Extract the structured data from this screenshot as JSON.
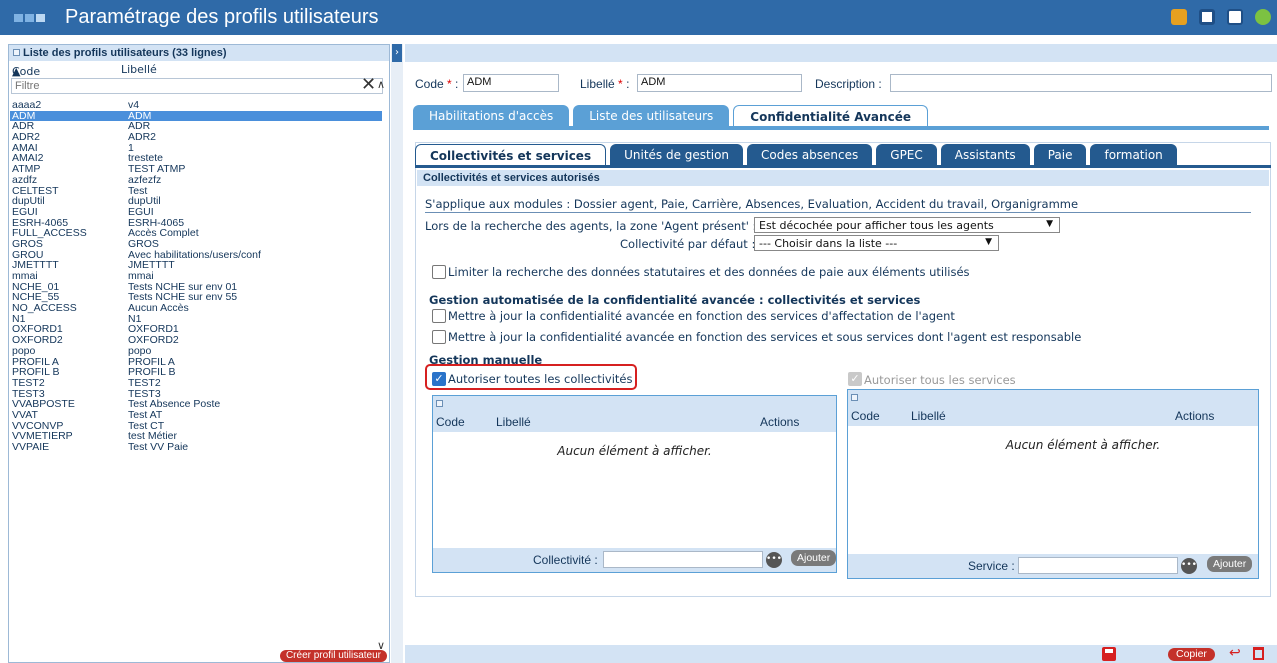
{
  "window": {
    "title": "Paramétrage des profils utilisateurs"
  },
  "left": {
    "header": "Liste des profils utilisateurs (33 lignes)",
    "col_code": "Code",
    "col_label": "Libellé",
    "filter_placeholder": "Filtre",
    "create_button": "Créer profil utilisateur",
    "rows": [
      {
        "code": "aaaa2",
        "label": "v4"
      },
      {
        "code": "ADM",
        "label": "ADM",
        "selected": true
      },
      {
        "code": "ADR",
        "label": "ADR"
      },
      {
        "code": "ADR2",
        "label": "ADR2"
      },
      {
        "code": "AMAI",
        "label": "1"
      },
      {
        "code": "AMAI2",
        "label": "trestete"
      },
      {
        "code": "ATMP",
        "label": "TEST ATMP"
      },
      {
        "code": "azdfz",
        "label": "azfezfz"
      },
      {
        "code": "CELTEST",
        "label": "Test"
      },
      {
        "code": "dupUtil",
        "label": "dupUtil"
      },
      {
        "code": "EGUI",
        "label": "EGUI"
      },
      {
        "code": "ESRH-4065",
        "label": "ESRH-4065"
      },
      {
        "code": "FULL_ACCESS",
        "label": "Accès Complet"
      },
      {
        "code": "GROS",
        "label": "GROS"
      },
      {
        "code": "GROU",
        "label": "Avec habilitations/users/conf"
      },
      {
        "code": "JMETTTT",
        "label": "JMETTTT"
      },
      {
        "code": "mmai",
        "label": "mmai"
      },
      {
        "code": "NCHE_01",
        "label": "Tests NCHE sur env 01"
      },
      {
        "code": "NCHE_55",
        "label": "Tests NCHE sur env 55"
      },
      {
        "code": "NO_ACCESS",
        "label": "Aucun Accès"
      },
      {
        "code": "N1",
        "label": "N1"
      },
      {
        "code": "OXFORD1",
        "label": "OXFORD1"
      },
      {
        "code": "OXFORD2",
        "label": "OXFORD2"
      },
      {
        "code": "popo",
        "label": "popo"
      },
      {
        "code": "PROFIL A",
        "label": "PROFIL A"
      },
      {
        "code": "PROFIL B",
        "label": "PROFIL B"
      },
      {
        "code": "TEST2",
        "label": "TEST2"
      },
      {
        "code": "TEST3",
        "label": "TEST3"
      },
      {
        "code": "VVABPOSTE",
        "label": "Test Absence Poste"
      },
      {
        "code": "VVAT",
        "label": "Test AT"
      },
      {
        "code": "VVCONVP",
        "label": "Test CT"
      },
      {
        "code": "VVMETIERP",
        "label": "test Métier"
      },
      {
        "code": "VVPAIE",
        "label": "Test VV Paie"
      }
    ]
  },
  "form": {
    "code_label": "Code",
    "code_value": "ADM",
    "libelle_label": "Libellé",
    "libelle_value": "ADM",
    "description_label": "Description :",
    "description_value": "",
    "required_mark": "*",
    "colon": ":"
  },
  "tabs_main": [
    {
      "label": "Habilitations d'accès"
    },
    {
      "label": "Liste des utilisateurs"
    },
    {
      "label": "Confidentialité Avancée",
      "active": true
    }
  ],
  "tabs_sub": [
    {
      "label": "Collectivités et services",
      "active": true
    },
    {
      "label": "Unités de gestion"
    },
    {
      "label": "Codes absences"
    },
    {
      "label": "GPEC"
    },
    {
      "label": "Assistants"
    },
    {
      "label": "Paie"
    },
    {
      "label": "formation"
    }
  ],
  "section": {
    "title": "Collectivités et services autorisés",
    "applies": "S'applique aux modules : Dossier agent, Paie, Carrière, Absences, Evaluation, Accident du travail, Organigramme",
    "search_zone_label": "Lors de la recherche des agents, la zone 'Agent présent' :",
    "search_zone_value": "Est décochée pour afficher tous les agents",
    "default_coll_label": "Collectivité par défaut :",
    "default_coll_value": "--- Choisir dans la liste ---",
    "limit_label": "Limiter la recherche des données statutaires et des données de paie aux éléments utilisés",
    "auto_title": "Gestion automatisée de la confidentialité avancée : collectivités et services",
    "auto_opt1": "Mettre à jour la confidentialité avancée en fonction des services d'affectation de l'agent",
    "auto_opt2": "Mettre à jour la confidentialité avancée en fonction des services et sous services dont l'agent est responsable",
    "manual_title": "Gestion manuelle",
    "all_coll_label": "Autoriser toutes les collectivités",
    "all_coll_checked": true,
    "all_serv_label": "Autoriser tous les services",
    "all_serv_checked": true
  },
  "grid_coll": {
    "col_code": "Code",
    "col_label": "Libellé",
    "col_actions": "Actions",
    "empty": "Aucun élément à afficher.",
    "footer_label": "Collectivité :",
    "add_button": "Ajouter"
  },
  "grid_serv": {
    "col_code": "Code",
    "col_label": "Libellé",
    "col_actions": "Actions",
    "empty": "Aucun élément à afficher.",
    "footer_label": "Service :",
    "add_button": "Ajouter"
  },
  "footer": {
    "copy_button": "Copier"
  },
  "colors": {
    "titlebar": "#2f6aa8",
    "selected_row": "#4a8fdb",
    "tab_light": "#5ba0d6",
    "tab_dark": "#245a8f",
    "danger": "#d62020"
  }
}
